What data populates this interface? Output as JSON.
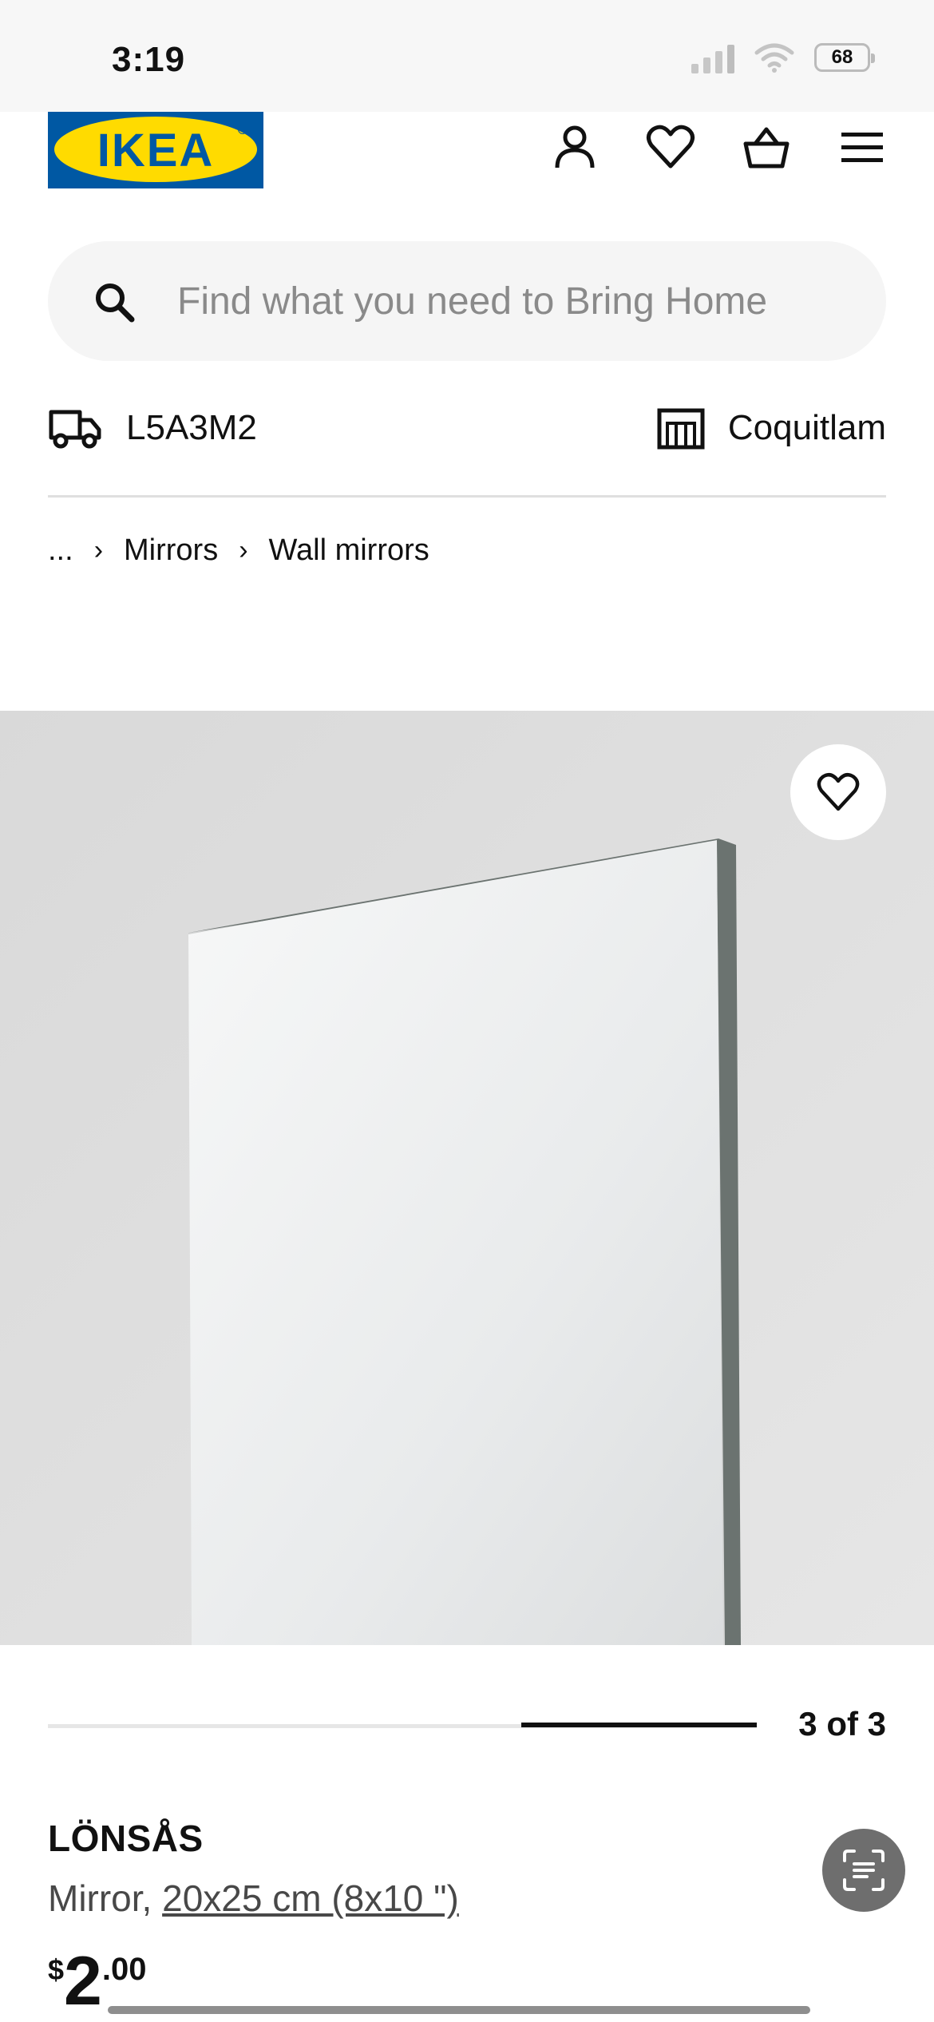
{
  "status_bar": {
    "time": "3:19",
    "battery": "68"
  },
  "header": {
    "logo_text": "IKEA"
  },
  "search": {
    "placeholder": "Find what you need to Bring Home"
  },
  "location": {
    "postal_code": "L5A3M2",
    "store": "Coquitlam"
  },
  "breadcrumb": {
    "ellipsis": "...",
    "items": [
      "Mirrors",
      "Wall mirrors"
    ]
  },
  "gallery": {
    "pager": "3 of 3",
    "progress_fraction": 1.0
  },
  "product": {
    "name": "LÖNSÅS",
    "type": "Mirror, ",
    "size": "20x25 cm (8x10 \")",
    "price_currency": "$",
    "price_integer": "2",
    "price_decimal": ".00"
  },
  "colors": {
    "ikea_blue": "#0058a3",
    "ikea_yellow": "#ffdb00"
  }
}
